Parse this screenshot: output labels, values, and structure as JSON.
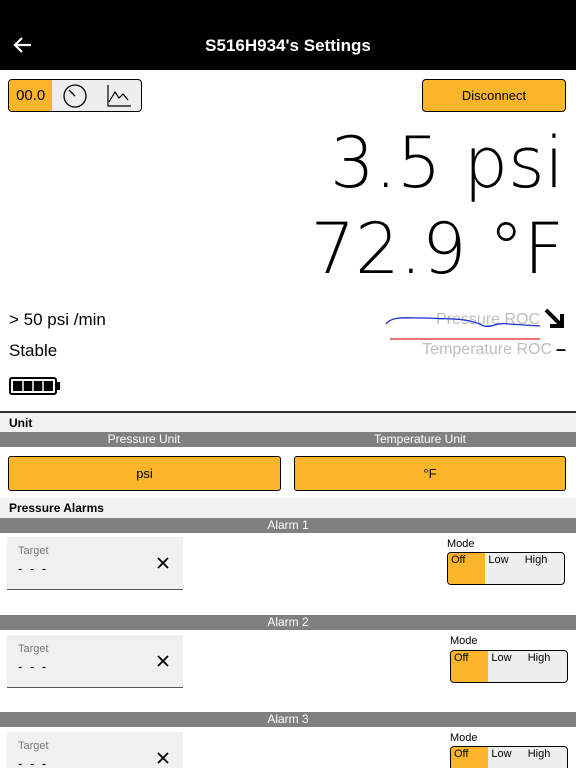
{
  "header": {
    "title": "S516H934's Settings",
    "back_icon": "arrow-left-icon"
  },
  "display_mode": {
    "digital_label": "00.0",
    "gauge_icon": "gauge-icon",
    "graph_icon": "line-graph-icon",
    "selected": "digital"
  },
  "disconnect_label": "Disconnect",
  "readings": {
    "pressure": "3.5 psi",
    "temperature": "72.9 °F"
  },
  "roc": {
    "pressure_value": "> 50 psi /min",
    "temperature_value": "Stable",
    "pressure_legend": "Pressure ROC",
    "temperature_legend": "Temperature ROC",
    "pressure_trend_icon": "arrow-down-right-icon",
    "temperature_trend_symbol": "–",
    "pressure_line_color": "#1a2fd6",
    "temperature_line_color": "#e02020"
  },
  "battery": {
    "icon": "battery-icon",
    "level": 1.0
  },
  "unit_section": {
    "title": "Unit",
    "pressure_unit_label": "Pressure Unit",
    "temperature_unit_label": "Temperature Unit",
    "pressure_unit_value": "psi",
    "temperature_unit_value": "°F"
  },
  "alarms_section": {
    "title": "Pressure Alarms",
    "alarms": [
      {
        "name": "Alarm 1",
        "target_label": "Target",
        "target_value": "- - -",
        "mode_label": "Mode",
        "options": [
          "Off",
          "Low",
          "High"
        ],
        "selected": "Off"
      },
      {
        "name": "Alarm 2",
        "target_label": "Target",
        "target_value": "- - -",
        "mode_label": "Mode",
        "options": [
          "Off",
          "Low",
          "High"
        ],
        "selected": "Off"
      },
      {
        "name": "Alarm 3",
        "target_label": "Target",
        "target_value": "- - -",
        "mode_label": "Mode",
        "options": [
          "Off",
          "Low",
          "High"
        ],
        "selected": "Off"
      }
    ]
  },
  "colors": {
    "accent": "#fbb52b",
    "header_bg": "#000000",
    "bar_gray": "#808080"
  }
}
